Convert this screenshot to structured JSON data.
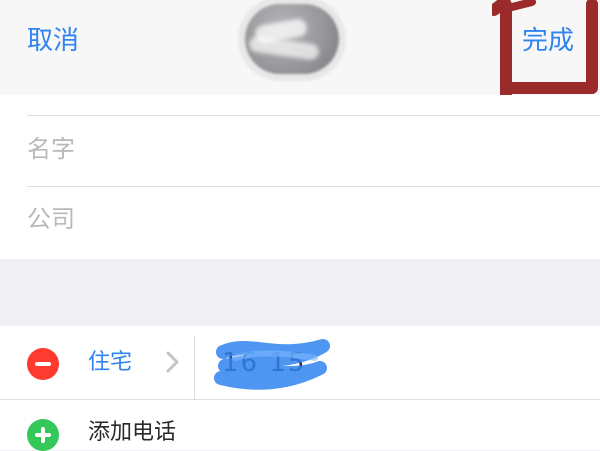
{
  "header": {
    "cancel_label": "取消",
    "done_label": "完成"
  },
  "fields": {
    "name_placeholder": "名字",
    "company_placeholder": "公司"
  },
  "phone": {
    "type_label": "住宅",
    "value_visible": "16 15"
  },
  "add_phone_label": "添加电话",
  "colors": {
    "accent": "#2f84f0",
    "remove_red": "#ff3b30",
    "add_green": "#34c759",
    "highlight_red": "#9b2a2a",
    "background": "#efeff4"
  },
  "icons": {
    "remove": "minus-circle-icon",
    "add": "plus-circle-icon",
    "chevron": "chevron-right-icon"
  }
}
